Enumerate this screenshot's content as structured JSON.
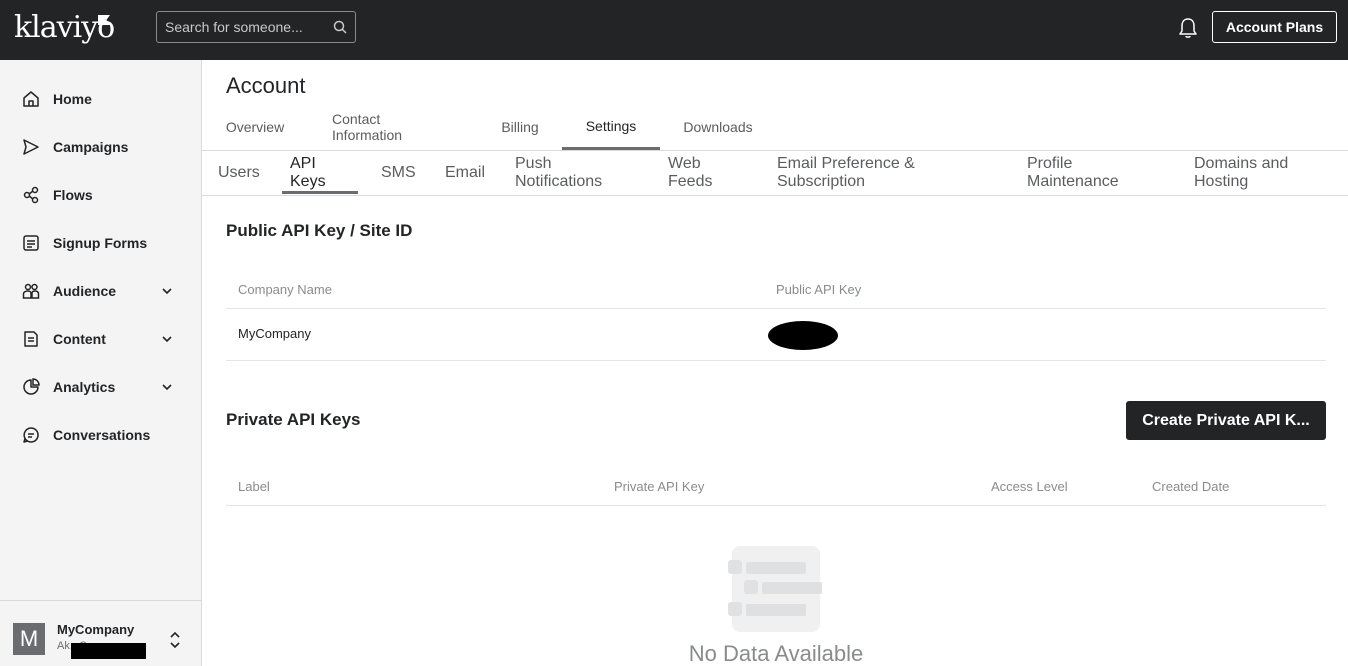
{
  "topbar": {
    "logo": "klaviyo",
    "search_placeholder": "Search for someone...",
    "search_icon": "search-icon",
    "bell_icon": "bell-icon",
    "account_plans_label": "Account Plans"
  },
  "sidebar": {
    "items": [
      {
        "label": "Home",
        "icon": "home-icon",
        "has_chevron": false
      },
      {
        "label": "Campaigns",
        "icon": "send-icon",
        "has_chevron": false
      },
      {
        "label": "Flows",
        "icon": "flows-icon",
        "has_chevron": false
      },
      {
        "label": "Signup Forms",
        "icon": "form-icon",
        "has_chevron": false
      },
      {
        "label": "Audience",
        "icon": "audience-icon",
        "has_chevron": true
      },
      {
        "label": "Content",
        "icon": "content-icon",
        "has_chevron": true
      },
      {
        "label": "Analytics",
        "icon": "analytics-icon",
        "has_chevron": true
      },
      {
        "label": "Conversations",
        "icon": "chat-icon",
        "has_chevron": false
      }
    ],
    "account": {
      "avatar_letter": "M",
      "name": "MyCompany",
      "sub": "Ak...Co...."
    }
  },
  "main": {
    "title": "Account",
    "tabs": [
      "Overview",
      "Contact Information",
      "Billing",
      "Settings",
      "Downloads"
    ],
    "active_tab": "Settings",
    "subtabs": [
      "Users",
      "API Keys",
      "SMS",
      "Email",
      "Push Notifications",
      "Web Feeds",
      "Email Preference & Subscription",
      "Profile Maintenance",
      "Domains and Hosting"
    ],
    "active_subtab": "API Keys",
    "public_section": {
      "title": "Public API Key / Site ID",
      "headers": [
        "Company Name",
        "Public API Key"
      ],
      "rows": [
        {
          "company": "MyCompany",
          "key": ""
        }
      ]
    },
    "private_section": {
      "title": "Private API Keys",
      "create_button": "Create Private API K...",
      "headers": [
        "Label",
        "Private API Key",
        "Access Level",
        "Created Date"
      ],
      "empty_text": "No Data Available"
    }
  },
  "colors": {
    "topbar_bg": "#232426",
    "sidebar_bg": "#f4f4f5",
    "primary_button": "#232426",
    "muted_text": "#8a8b8d"
  }
}
